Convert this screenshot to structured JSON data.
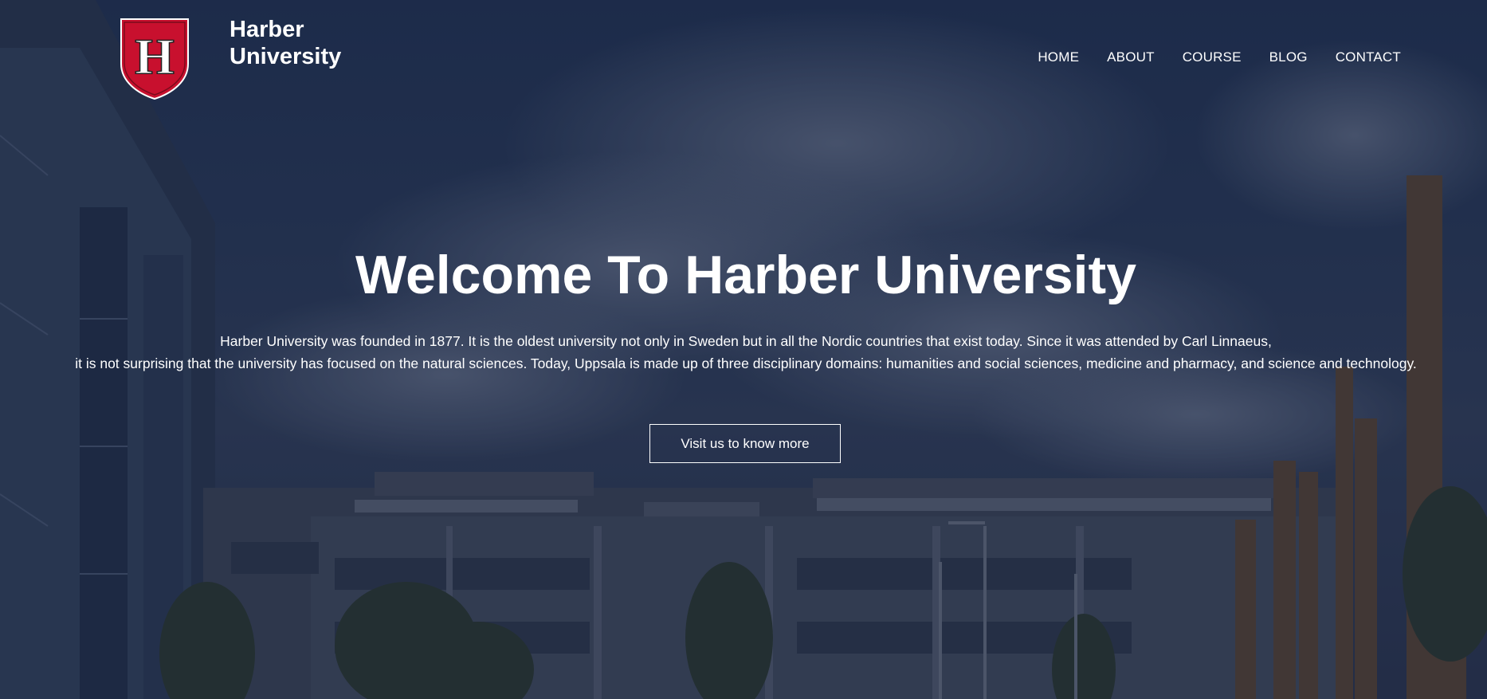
{
  "brand": {
    "logo_letter": "H",
    "name_line1": "Harber",
    "name_line2": "University"
  },
  "nav": {
    "items": [
      "HOME",
      "ABOUT",
      "COURSE",
      "BLOG",
      "CONTACT"
    ]
  },
  "hero": {
    "title": "Welcome To Harber University",
    "desc_line1": "Harber University was founded in 1877. It is the oldest university not only in Sweden but in all the Nordic countries that exist today. Since it was attended by Carl Linnaeus,",
    "desc_line2": "it is not surprising that the university has focused on the natural sciences. Today, Uppsala is made up of three disciplinary domains: humanities and social sciences, medicine and pharmacy, and science and technology.",
    "cta_label": "Visit us to know more"
  },
  "colors": {
    "shield_red": "#c8102e",
    "text": "#ffffff",
    "sky": "#223455"
  }
}
